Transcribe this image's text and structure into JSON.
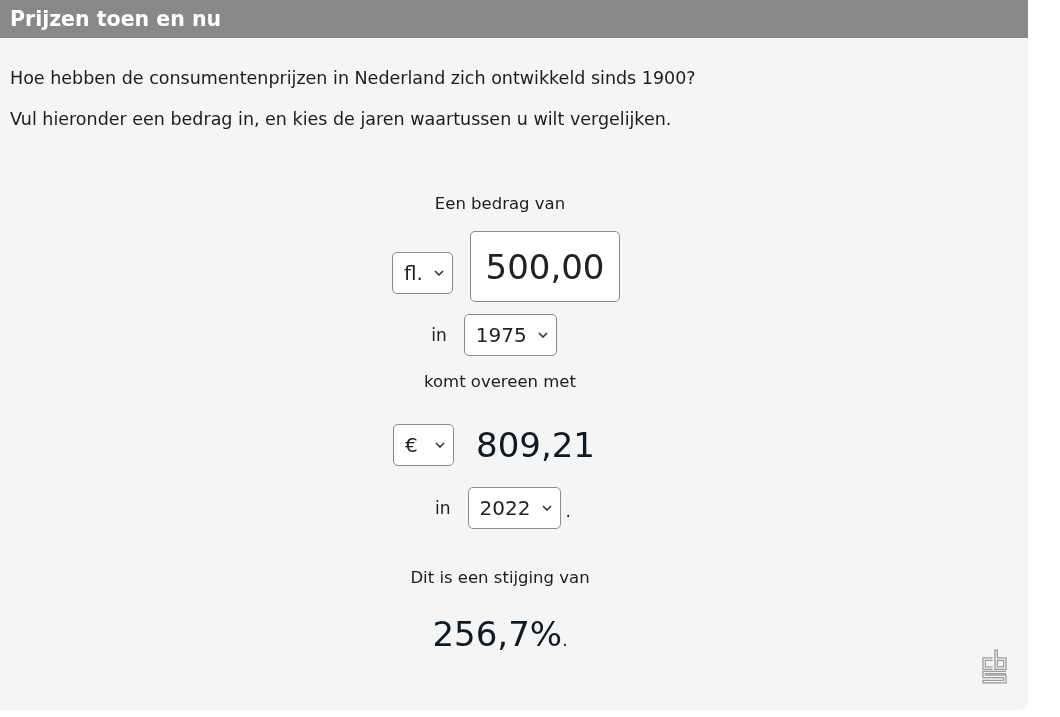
{
  "header": {
    "title": "Prijzen toen en nu"
  },
  "intro": [
    "Hoe hebben de consumentenprijzen in Nederland zich ontwikkeld sinds 1900?",
    "Vul hieronder een bedrag in, en kies de jaren waartussen u wilt vergelijken."
  ],
  "calculator": {
    "amount_label": "Een bedrag van",
    "from_currency": "fl.",
    "amount_input": {
      "value": "500,00"
    },
    "from_year_label": "in",
    "from_year": "1975",
    "result_label": "komt overeen met",
    "to_currency": "€",
    "result_amount": "809,21",
    "to_year_label": "in",
    "to_year": "2022",
    "to_year_suffix": ".",
    "increase_label": "Dit is een stijging van",
    "increase_value": "256,7%",
    "increase_suffix": "."
  }
}
